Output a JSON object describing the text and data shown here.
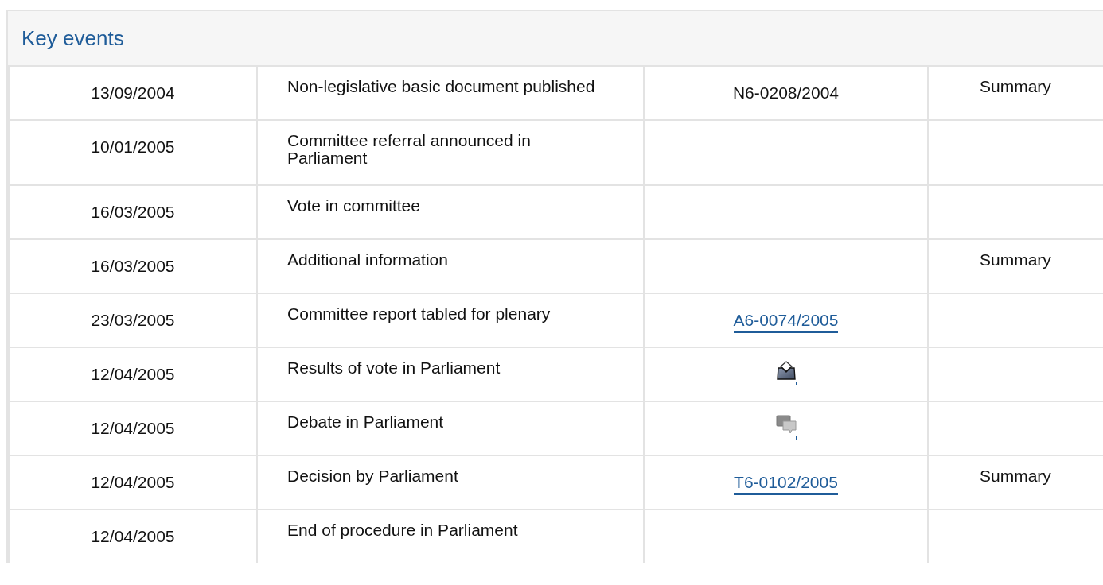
{
  "panel": {
    "title": "Key events"
  },
  "rows": [
    {
      "date": "13/09/2004",
      "event": "Non-legislative basic document published",
      "reference": {
        "kind": "text",
        "text": "N6-0208/2004"
      },
      "summary": "Summary"
    },
    {
      "date": "10/01/2005",
      "event": "Committee referral announced in Parliament",
      "reference": {
        "kind": "none"
      },
      "summary": ""
    },
    {
      "date": "16/03/2005",
      "event": "Vote in committee",
      "reference": {
        "kind": "none"
      },
      "summary": ""
    },
    {
      "date": "16/03/2005",
      "event": "Additional information",
      "reference": {
        "kind": "none"
      },
      "summary": "Summary"
    },
    {
      "date": "23/03/2005",
      "event": "Committee report tabled for plenary",
      "reference": {
        "kind": "link",
        "text": "A6-0074/2005"
      },
      "summary": ""
    },
    {
      "date": "12/04/2005",
      "event": "Results of vote in Parliament",
      "reference": {
        "kind": "ballot"
      },
      "summary": ""
    },
    {
      "date": "12/04/2005",
      "event": "Debate in Parliament",
      "reference": {
        "kind": "chat"
      },
      "summary": ""
    },
    {
      "date": "12/04/2005",
      "event": "Decision by Parliament",
      "reference": {
        "kind": "link",
        "text": "T6-0102/2005"
      },
      "summary": "Summary"
    },
    {
      "date": "12/04/2005",
      "event": "End of procedure in Parliament",
      "reference": {
        "kind": "none"
      },
      "summary": ""
    }
  ]
}
